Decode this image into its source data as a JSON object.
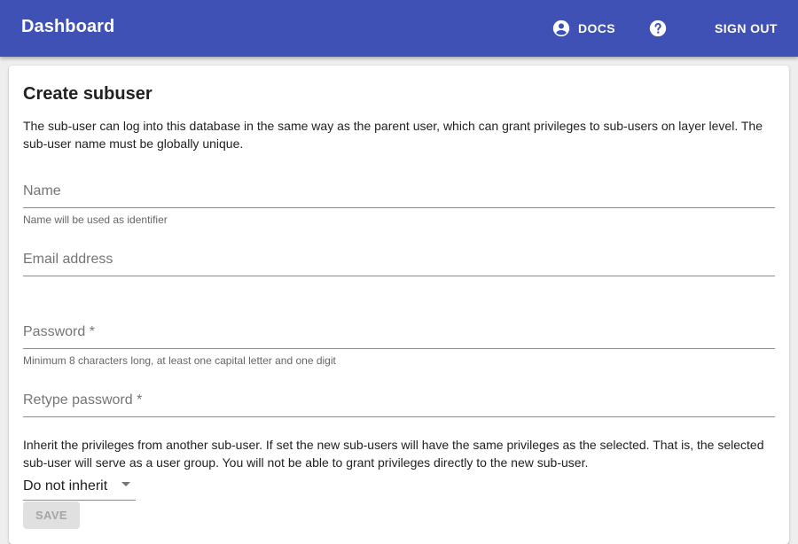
{
  "appbar": {
    "title": "Dashboard",
    "docs_label": "DOCS",
    "docs_icon": "account-circle-icon",
    "help_icon": "help-circle-icon",
    "signout_label": "SIGN OUT",
    "color": "#3f51b5"
  },
  "form": {
    "title": "Create subuser",
    "description": "The sub-user can log into this database in the same way as the parent user, which can grant privileges to sub-users on layer level. The sub-user name must be globally unique.",
    "name": {
      "placeholder": "Name",
      "value": "",
      "helper": "Name will be used as identifier"
    },
    "email": {
      "placeholder": "Email address",
      "value": ""
    },
    "password": {
      "placeholder": "Password *",
      "value": "",
      "helper": "Minimum 8 characters long, at least one capital letter and one digit"
    },
    "retype_password": {
      "placeholder": "Retype password *",
      "value": ""
    },
    "inherit_description": "Inherit the privileges from another sub-user. If set the new sub-users will have the same privileges as the selected. That is, the selected sub-user will serve as a user group. You will not be able to grant privileges directly to the new sub-user.",
    "inherit_select": {
      "selected": "Do not inherit"
    },
    "save_label": "SAVE",
    "save_disabled": true
  }
}
